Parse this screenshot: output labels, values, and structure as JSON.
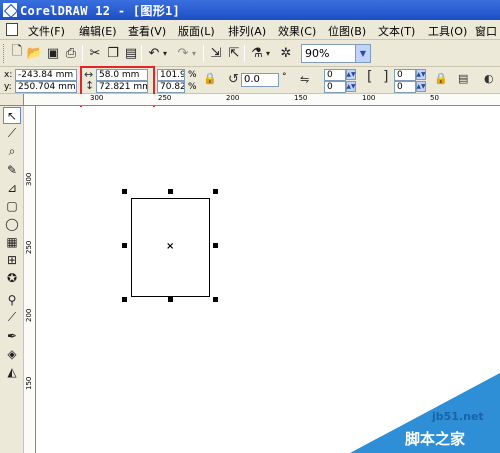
{
  "window": {
    "title": "CorelDRAW 12 - [图形1]"
  },
  "menu": {
    "items": [
      "文件(F)",
      "编辑(E)",
      "查看(V)",
      "版面(L)",
      "排列(A)",
      "效果(C)",
      "位图(B)",
      "文本(T)",
      "工具(O)",
      "窗口"
    ]
  },
  "toolbar": {
    "icons": [
      "new-icon",
      "open-icon",
      "save-icon",
      "print-icon",
      "cut-icon",
      "copy-icon",
      "paste-icon",
      "undo-icon",
      "redo-icon",
      "import-icon",
      "export-icon",
      "app-launcher-icon",
      "corel-online-icon"
    ],
    "zoom": "90%"
  },
  "property_bar": {
    "x_label": "x:",
    "x_value": "-243.84 mm",
    "y_label": "y:",
    "y_value": "250.704 mm",
    "width_value": "58.0 mm",
    "height_value": "72.821 mm",
    "scale_x": "101.9",
    "scale_y": "70.82",
    "percent": "%",
    "rotation": "0.0",
    "degree": "°",
    "corner_values": [
      "0",
      "0",
      "0",
      "0"
    ]
  },
  "rulers": {
    "horizontal_labels": [
      "300",
      "250",
      "200",
      "150",
      "100",
      "50"
    ],
    "vertical_labels": [
      "300",
      "250",
      "200",
      "150"
    ]
  },
  "toolbox": {
    "tools": [
      "pick-tool-icon",
      "shape-tool-icon",
      "zoom-tool-icon",
      "freehand-tool-icon",
      "smart-fill-icon",
      "rectangle-tool-icon",
      "ellipse-tool-icon",
      "polygon-tool-icon",
      "basic-shapes-icon",
      "text-tool-icon",
      "interactive-blend-icon",
      "eyedropper-icon",
      "outline-tool-icon",
      "fill-tool-icon",
      "interactive-fill-icon"
    ]
  },
  "watermark": {
    "site": "jb51.net",
    "text": "脚本之家"
  }
}
